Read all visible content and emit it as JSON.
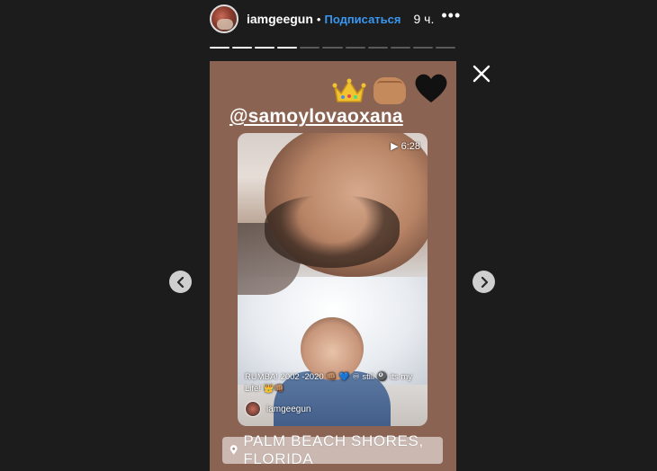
{
  "header": {
    "username": "iamgeegun",
    "separator": "•",
    "follow_label": "Подписаться",
    "time": "9 ч.",
    "more": "•••"
  },
  "progress": {
    "segments": 11,
    "completed": 4
  },
  "story": {
    "mention": "@samoylovaoxana",
    "emojis": [
      "crown-emoji",
      "fist-emoji",
      "black-heart-emoji"
    ],
    "video_time": "▶ 6:28",
    "caption": "RUMBA! 2002 -2020 👊🏽 💙 ♾ still 🎱 its my Life! 👑👊🏽",
    "reshared_user": "iamgeegun",
    "location": "PALM BEACH SHORES, FLORIDA"
  },
  "icons": {
    "close": "close-icon",
    "prev": "chevron-left-icon",
    "next": "chevron-right-icon",
    "pin": "location-pin-icon"
  },
  "colors": {
    "background": "#1c1c1c",
    "story_bg": "#8b6352",
    "follow": "#3897f0"
  }
}
